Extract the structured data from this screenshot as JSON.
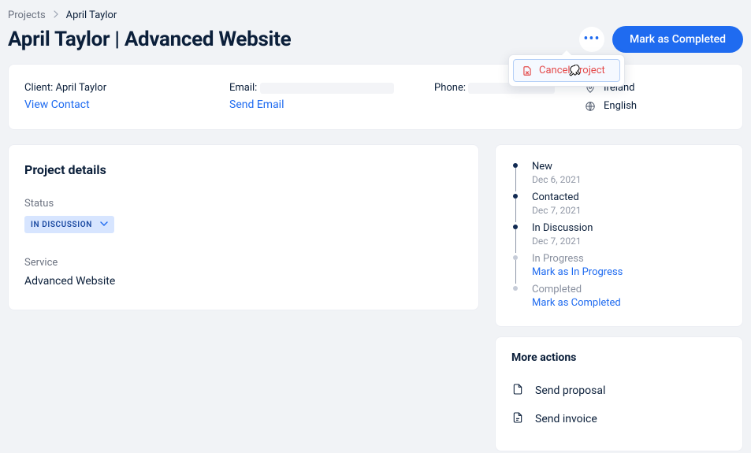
{
  "breadcrumb": {
    "root": "Projects",
    "current": "April Taylor"
  },
  "header": {
    "title": "April Taylor | Advanced Website",
    "primary_action": "Mark as Completed",
    "more_menu": {
      "cancel": "Cancel Project"
    }
  },
  "contact": {
    "client_label": "Client: April Taylor",
    "view_contact": "View Contact",
    "email_label": "Email:",
    "send_email": "Send Email",
    "phone_label": "Phone:",
    "country": "Ireland",
    "language": "English"
  },
  "details": {
    "heading": "Project details",
    "status_label": "Status",
    "status_value": "IN DISCUSSION",
    "service_label": "Service",
    "service_value": "Advanced Website"
  },
  "timeline": [
    {
      "title": "New",
      "subtitle": "Dec 6, 2021",
      "active": true,
      "link": null
    },
    {
      "title": "Contacted",
      "subtitle": "Dec 7, 2021",
      "active": true,
      "link": null
    },
    {
      "title": "In Discussion",
      "subtitle": "Dec 7, 2021",
      "active": true,
      "link": null
    },
    {
      "title": "In Progress",
      "subtitle": null,
      "active": false,
      "link": "Mark as In Progress"
    },
    {
      "title": "Completed",
      "subtitle": null,
      "active": false,
      "link": "Mark as Completed"
    }
  ],
  "more_actions": {
    "heading": "More actions",
    "items": [
      {
        "label": "Send proposal",
        "icon": "file-icon"
      },
      {
        "label": "Send invoice",
        "icon": "invoice-icon"
      }
    ]
  }
}
